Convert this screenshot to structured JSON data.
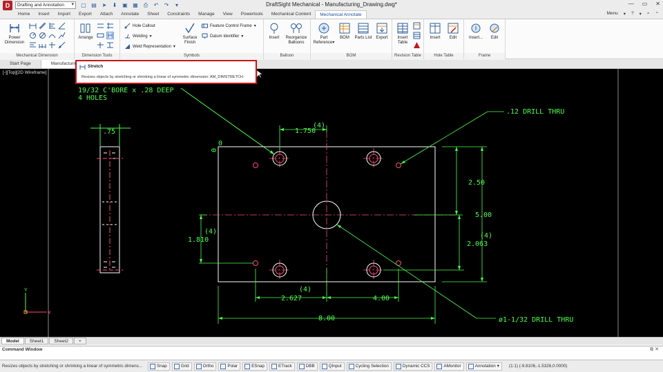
{
  "app": {
    "title": "DraftSight Mechanical - Manufacturing_Drawing.dwg*",
    "workspace": "Drafting and Annotation"
  },
  "tabs": [
    "Home",
    "Insert",
    "Import",
    "Export",
    "Attach",
    "Annotate",
    "Sheet",
    "Constraints",
    "Manage",
    "View",
    "Powertools",
    "Mechanical Content",
    "Mechanical Annotate"
  ],
  "active_tab": "Mechanical Annotate",
  "menu_label": "Menu",
  "ribbon": {
    "mechanical_dimension": {
      "label": "Mechanical Dimension",
      "power_dimension": "Power\nDimension"
    },
    "dimension_tools": {
      "label": "Dimension Tools",
      "arrange": "Arrange"
    },
    "symbols": {
      "label": "Symbols",
      "hole_callout": "Hole Callout",
      "welding": "Welding",
      "weld_representation": "Weld Representation",
      "surface_finish": "Surface\nFinish",
      "feature_control_frame": "Feature Control Frame",
      "datum_identifier": "Datum Identifier"
    },
    "balloon": {
      "label": "Balloon",
      "insert": "Insert",
      "reorganize": "Reorganize\nBalloons"
    },
    "bom": {
      "label": "BOM",
      "part_reference": "Part\nReference",
      "bom": "BOM",
      "parts_list": "Parts List",
      "export": "Export"
    },
    "revision_table": {
      "label": "Revision Table",
      "insert_table": "Insert\nTable"
    },
    "hole_table": {
      "label": "Hole Table",
      "insert": "Insert",
      "edit": "Edit"
    },
    "frame": {
      "label": "Frame",
      "insert": "Insert...",
      "edit": "Edit"
    }
  },
  "tooltip": {
    "title": "Stretch",
    "description": "Resizes objects by stretching or shrinking a linear of symmetric dimension:  AM_DIMSTRETCH"
  },
  "doc_tabs": [
    "Start Page",
    "Manufacturing"
  ],
  "view_label": "[-][Top][2D Wireframe]",
  "drawing": {
    "note_cbore": "19/32 C'BORE x .28 DEEP",
    "note_holes": "4 HOLES",
    "dim_075": ".75",
    "dim_1750": "1.750",
    "dim_4_top": "(4)",
    "dim_0_top": "0",
    "dim_0_left": "0",
    "drill_thru": ".12 DRILL THRU",
    "dim_250": "2.50",
    "dim_500": "5.00",
    "dim_2063": "2.063",
    "dim_4_right": "(4)",
    "dim_1810": "1.810",
    "dim_4_left": "(4)",
    "dim_2627": "2.627",
    "dim_4_bottom": "(4)",
    "dim_400": "4.00",
    "dim_800": "8.00",
    "big_drill": "ø1-1/32 DRILL THRU",
    "ucs_y": "Y",
    "ucs_x": "X"
  },
  "layout_tabs": [
    "Model",
    "Sheet1",
    "Sheet2"
  ],
  "command_window": {
    "title": "Command Window"
  },
  "status": {
    "message": "Resizes objects by stretching or shrinking a linear of symmetric dimens...",
    "buttons": [
      "Snap",
      "Grid",
      "Ortho",
      "Polar",
      "ESnap",
      "ETrack",
      "DBB",
      "QInput",
      "Cycling Selection",
      "Dynamic CCS",
      "AMonitor"
    ],
    "annotation": "Annotation",
    "scale": "(1:1)",
    "coords": "(-9.8106,-1.5326,0.0000)"
  },
  "colors": {
    "accent": "#1b4f91",
    "tooltip_border": "#c8141c",
    "cad_green": "#4cff4c",
    "cad_red": "#ff4c7a",
    "canvas": "#000000"
  }
}
